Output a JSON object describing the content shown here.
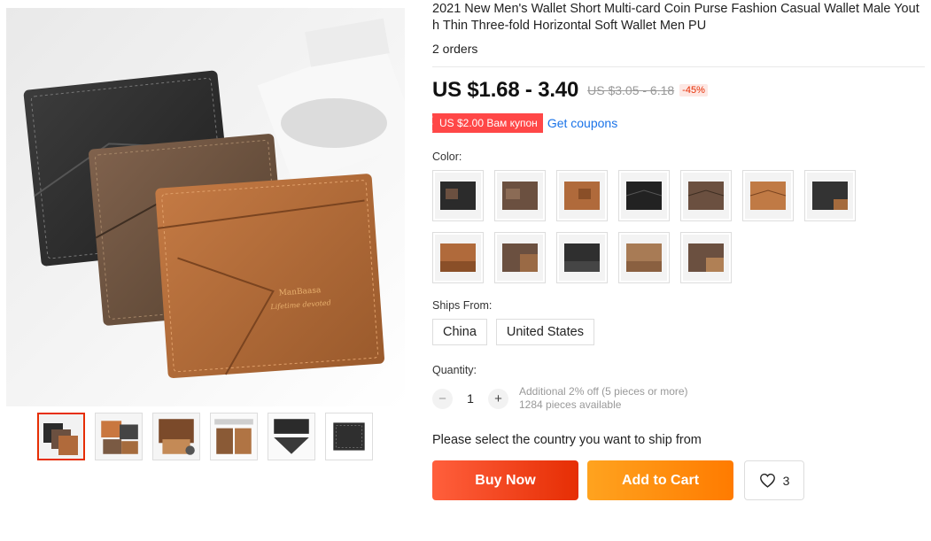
{
  "product": {
    "title": "2021 New Men's Wallet Short Multi-card Coin Purse Fashion Casual Wallet Male Youth Thin Three-fold Horizontal Soft Wallet Men PU",
    "orders": "2 orders"
  },
  "gallery": {
    "main_image_icon": "wallet-product-photo",
    "main_brand_text": "ManBaasa",
    "main_tagline_text": "Lifetime devoted",
    "thumbnail_count": 6
  },
  "price": {
    "current": "US $1.68 - 3.40",
    "original": "US $3.05 - 6.18",
    "discount": "-45%"
  },
  "coupon": {
    "label": "US $2.00 Вам купон",
    "link": "Get coupons"
  },
  "color": {
    "label": "Color:",
    "options_count": 12
  },
  "ships_from": {
    "label": "Ships From:",
    "options": [
      "China",
      "United States"
    ]
  },
  "quantity": {
    "label": "Quantity:",
    "minus": "−",
    "plus": "+",
    "value": "1",
    "additional": "Additional 2% off (5 pieces or more)",
    "available": "1284 pieces available"
  },
  "shipping_note": "Please select the country you want to ship from",
  "actions": {
    "buy_now": "Buy Now",
    "add_to_cart": "Add to Cart",
    "wishlist_count": "3",
    "wishlist_icon": "heart-icon"
  },
  "colors": {
    "accent_red": "#e62e04",
    "coupon_red": "#ff4747",
    "cart_orange": "#ff7b00",
    "link_blue": "#1a73e8",
    "wallet_black": "#2b2b2b",
    "wallet_coffee": "#6b5040",
    "wallet_brown": "#b06a3b"
  }
}
